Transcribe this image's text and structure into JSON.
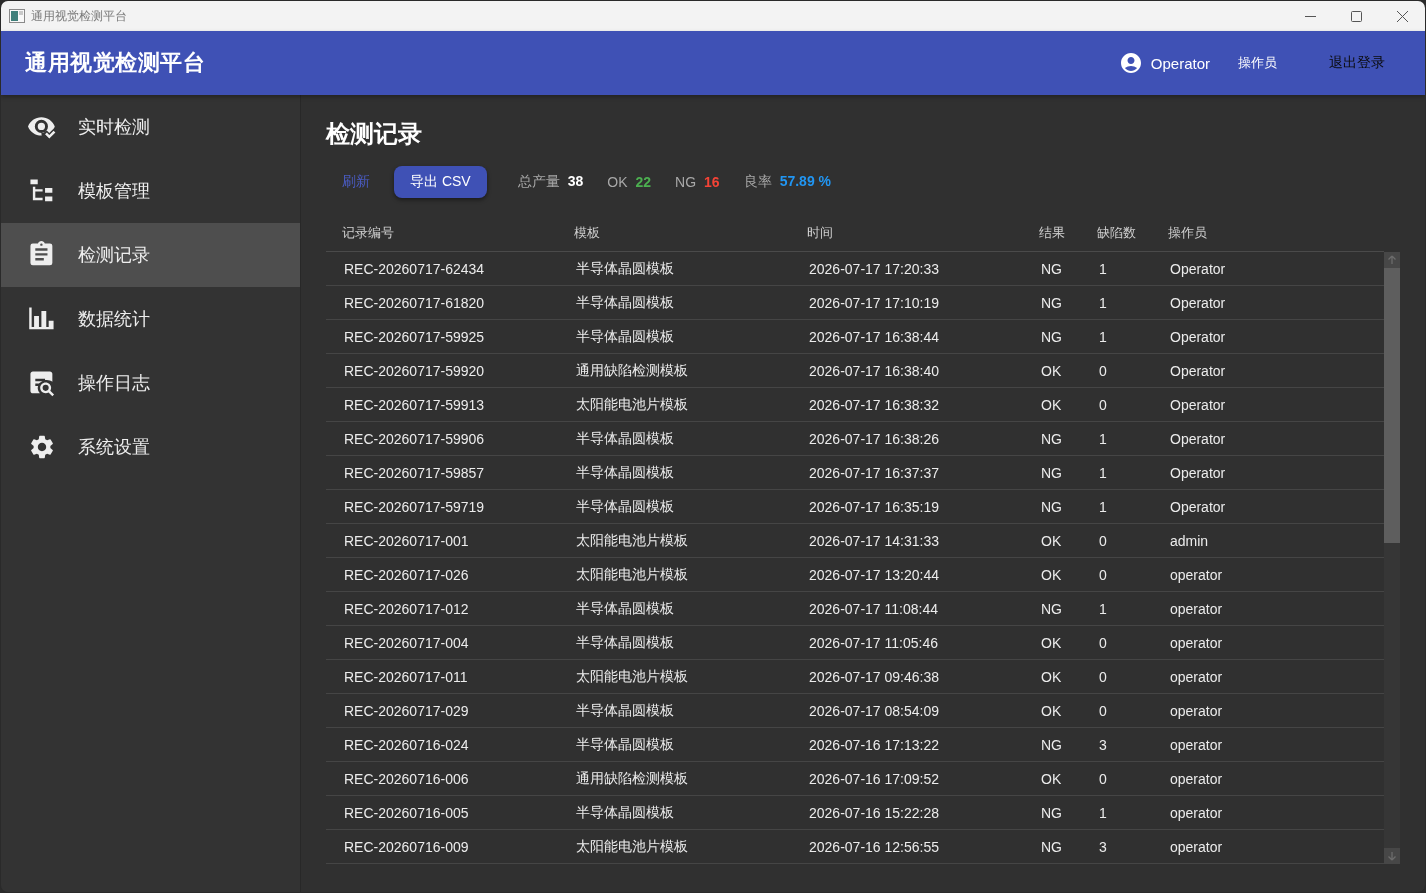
{
  "window": {
    "title": "通用视觉检测平台"
  },
  "header": {
    "app_title": "通用视觉检测平台",
    "user": "Operator",
    "role": "操作员",
    "logout": "退出登录"
  },
  "sidebar": {
    "items": [
      {
        "label": "实时检测",
        "selected": false
      },
      {
        "label": "模板管理",
        "selected": false
      },
      {
        "label": "检测记录",
        "selected": true
      },
      {
        "label": "数据统计",
        "selected": false
      },
      {
        "label": "操作日志",
        "selected": false
      },
      {
        "label": "系统设置",
        "selected": false
      }
    ]
  },
  "page": {
    "title": "检测记录",
    "refresh": "刷新",
    "export": "导出 CSV",
    "stats": [
      {
        "label": "总产量",
        "value": "38",
        "color": "#ffffff"
      },
      {
        "label": "OK",
        "value": "22",
        "color": "#4caf50"
      },
      {
        "label": "NG",
        "value": "16",
        "color": "#f44336"
      },
      {
        "label": "良率",
        "value": "57.89 %",
        "color": "#2196f3"
      }
    ]
  },
  "table": {
    "columns": [
      "记录编号",
      "模板",
      "时间",
      "结果",
      "缺陷数",
      "操作员"
    ],
    "rows": [
      [
        "REC-20260717-62434",
        "半导体晶圆模板",
        "2026-07-17 17:20:33",
        "NG",
        "1",
        "Operator"
      ],
      [
        "REC-20260717-61820",
        "半导体晶圆模板",
        "2026-07-17 17:10:19",
        "NG",
        "1",
        "Operator"
      ],
      [
        "REC-20260717-59925",
        "半导体晶圆模板",
        "2026-07-17 16:38:44",
        "NG",
        "1",
        "Operator"
      ],
      [
        "REC-20260717-59920",
        "通用缺陷检测模板",
        "2026-07-17 16:38:40",
        "OK",
        "0",
        "Operator"
      ],
      [
        "REC-20260717-59913",
        "太阳能电池片模板",
        "2026-07-17 16:38:32",
        "OK",
        "0",
        "Operator"
      ],
      [
        "REC-20260717-59906",
        "半导体晶圆模板",
        "2026-07-17 16:38:26",
        "NG",
        "1",
        "Operator"
      ],
      [
        "REC-20260717-59857",
        "半导体晶圆模板",
        "2026-07-17 16:37:37",
        "NG",
        "1",
        "Operator"
      ],
      [
        "REC-20260717-59719",
        "半导体晶圆模板",
        "2026-07-17 16:35:19",
        "NG",
        "1",
        "Operator"
      ],
      [
        "REC-20260717-001",
        "太阳能电池片模板",
        "2026-07-17 14:31:33",
        "OK",
        "0",
        "admin"
      ],
      [
        "REC-20260717-026",
        "太阳能电池片模板",
        "2026-07-17 13:20:44",
        "OK",
        "0",
        "operator"
      ],
      [
        "REC-20260717-012",
        "半导体晶圆模板",
        "2026-07-17 11:08:44",
        "NG",
        "1",
        "operator"
      ],
      [
        "REC-20260717-004",
        "半导体晶圆模板",
        "2026-07-17 11:05:46",
        "OK",
        "0",
        "operator"
      ],
      [
        "REC-20260717-011",
        "太阳能电池片模板",
        "2026-07-17 09:46:38",
        "OK",
        "0",
        "operator"
      ],
      [
        "REC-20260717-029",
        "半导体晶圆模板",
        "2026-07-17 08:54:09",
        "OK",
        "0",
        "operator"
      ],
      [
        "REC-20260716-024",
        "半导体晶圆模板",
        "2026-07-16 17:13:22",
        "NG",
        "3",
        "operator"
      ],
      [
        "REC-20260716-006",
        "通用缺陷检测模板",
        "2026-07-16 17:09:52",
        "OK",
        "0",
        "operator"
      ],
      [
        "REC-20260716-005",
        "半导体晶圆模板",
        "2026-07-16 15:22:28",
        "NG",
        "1",
        "operator"
      ],
      [
        "REC-20260716-009",
        "太阳能电池片模板",
        "2026-07-16 12:56:55",
        "NG",
        "3",
        "operator"
      ]
    ]
  }
}
